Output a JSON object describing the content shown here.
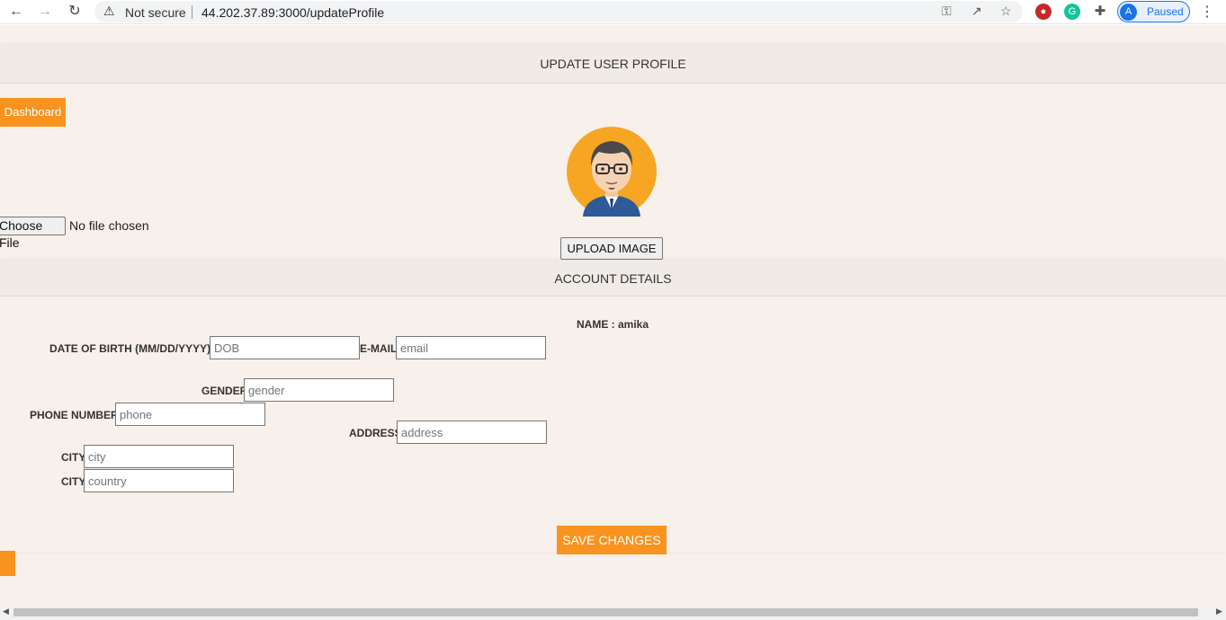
{
  "browser": {
    "security_label": "Not secure",
    "url": "44.202.37.89:3000/updateProfile",
    "profile_initial": "A",
    "profile_status": "Paused"
  },
  "header": {
    "title": "UPDATE USER PROFILE"
  },
  "dashboard_button": "Dashboard",
  "file_input": {
    "button_label": "Choose File",
    "status": "No file chosen"
  },
  "upload_button": "UPLOAD IMAGE",
  "account": {
    "title": "ACCOUNT DETAILS",
    "name_label": "NAME : amika"
  },
  "form": {
    "dob": {
      "label": "DATE OF BIRTH (MM/DD/YYYY)",
      "placeholder": "DOB"
    },
    "email": {
      "label": "E-MAIL",
      "placeholder": "email"
    },
    "gender": {
      "label": "GENDER",
      "placeholder": "gender"
    },
    "phone": {
      "label": "PHONE NUMBER",
      "placeholder": "phone"
    },
    "address": {
      "label": "ADDRESS",
      "placeholder": "address"
    },
    "city": {
      "label": "CITY",
      "placeholder": "city"
    },
    "country": {
      "label": "CITY",
      "placeholder": "country"
    }
  },
  "save_button": "SAVE CHANGES",
  "colors": {
    "accent": "#f7931e",
    "page_bg": "#f8f0ea",
    "header_bg": "#f0ebe6"
  },
  "icons": [
    "back-icon",
    "forward-icon",
    "reload-icon",
    "warning-icon",
    "key-icon",
    "share-icon",
    "star-icon",
    "extension-icon",
    "menu-icon"
  ]
}
